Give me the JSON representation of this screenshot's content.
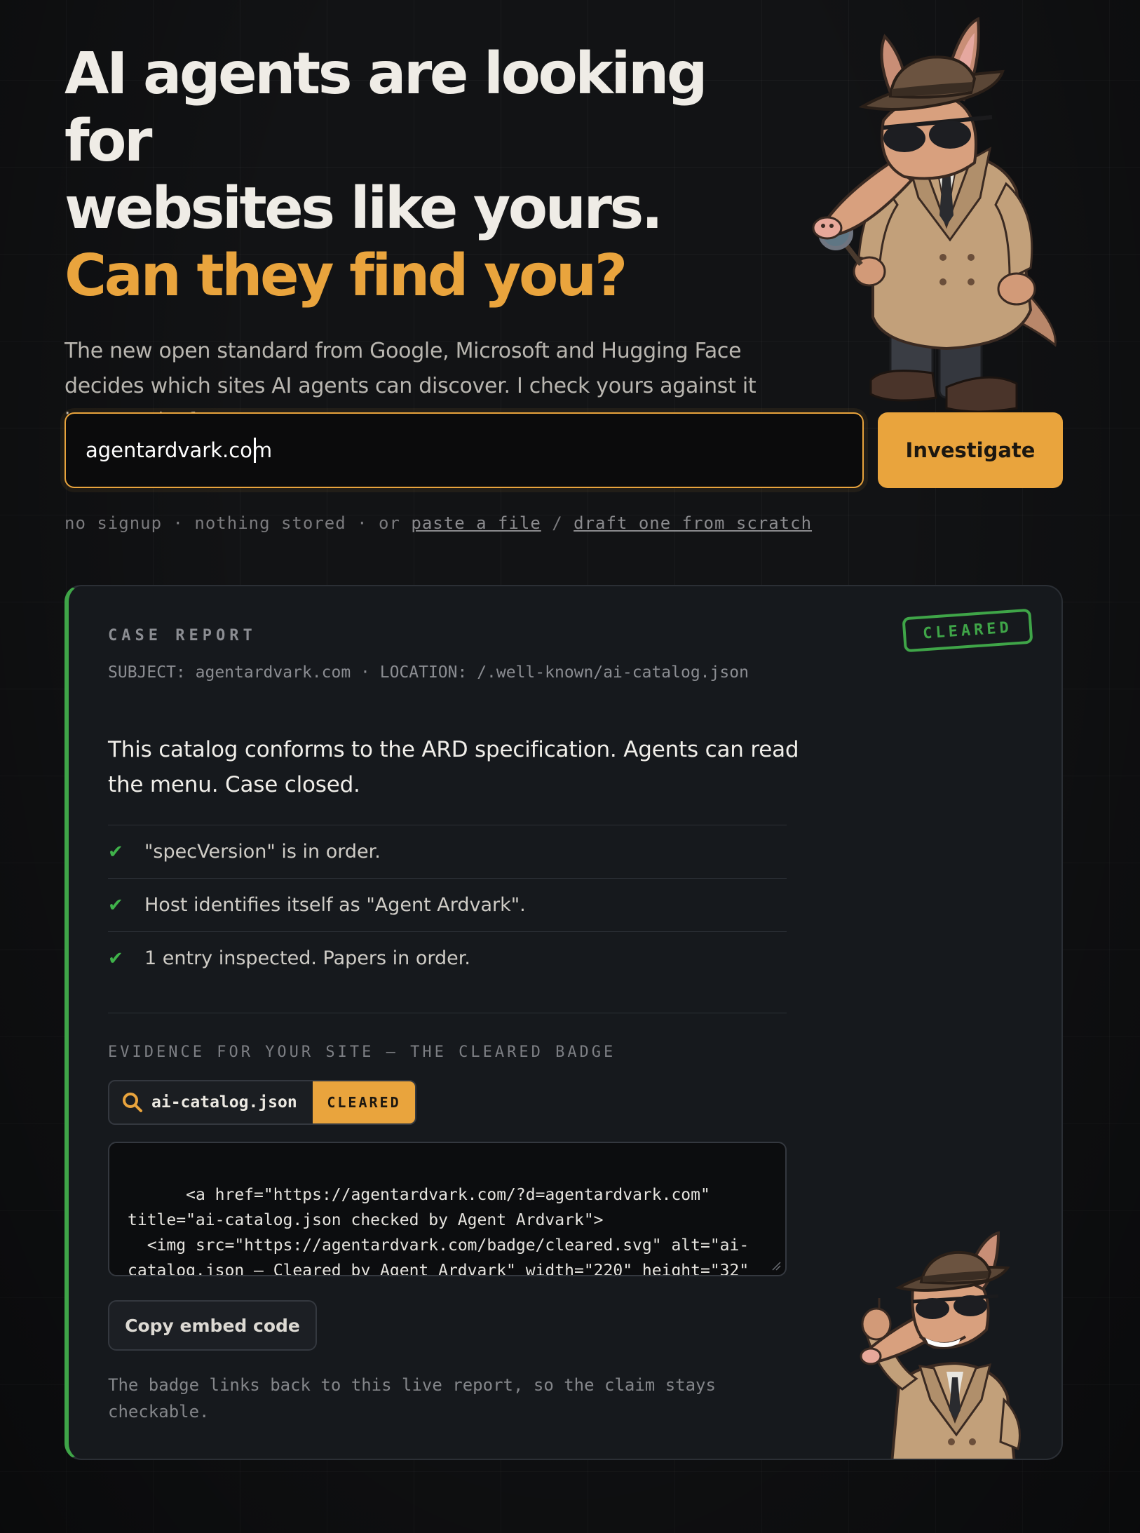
{
  "hero": {
    "line1": "AI agents are looking for",
    "line2": "websites like yours.",
    "line3": "Can they find you?",
    "description": "The new open standard from Google, Microsoft and Hugging Face decides which sites AI agents can discover. I check yours against it in seconds, free."
  },
  "search": {
    "value": "agentardvark.com",
    "button_label": "Investigate"
  },
  "sub_links": {
    "prefix": "no signup · nothing stored · or",
    "paste_link": "paste a file",
    "separator": "/",
    "draft_link": "draft one from scratch"
  },
  "report": {
    "label": "CASE REPORT",
    "meta": "SUBJECT: agentardvark.com  ·  LOCATION: /.well-known/ai-catalog.json",
    "stamp": "CLEARED",
    "verdict": "This catalog conforms to the ARD specification. Agents can read the menu. Case closed.",
    "checks": [
      "\"specVersion\" is in order.",
      "Host identifies itself as \"Agent Ardvark\".",
      "1 entry inspected. Papers in order."
    ],
    "evidence_title": "EVIDENCE FOR YOUR SITE — THE CLEARED BADGE",
    "badge": {
      "file": "ai-catalog.json",
      "status": "CLEARED"
    },
    "embed_code": "<a href=\"https://agentardvark.com/?d=agentardvark.com\" title=\"ai-catalog.json checked by Agent Ardvark\">\n  <img src=\"https://agentardvark.com/badge/cleared.svg\" alt=\"ai-catalog.json — Cleared by Agent Ardvark\" width=\"220\" height=\"32\" loading=\"lazy\">\n</a>",
    "copy_label": "Copy embed code",
    "footnote": "The badge links back to this live report, so the claim stays checkable."
  },
  "colors": {
    "accent": "#e9a43d",
    "success": "#3fa548",
    "background": "#121315"
  },
  "icons": {
    "badge": "magnifier-icon",
    "check": "check-icon"
  }
}
